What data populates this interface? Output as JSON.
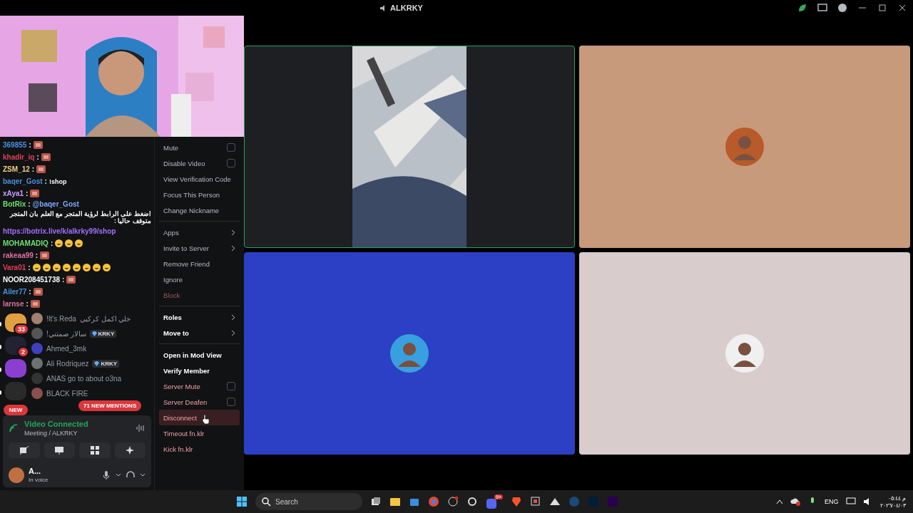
{
  "window": {
    "title": "ALKRKY"
  },
  "chat": [
    {
      "kind": "message",
      "user": "369855",
      "sep": ":",
      "color": "#4a90e2",
      "emotes": [
        {
          "kind": "sticker"
        }
      ]
    },
    {
      "kind": "message",
      "user": "khadir_iq",
      "sep": ":",
      "color": "#e0405a",
      "emotes": [
        {
          "kind": "sticker"
        }
      ]
    },
    {
      "kind": "message",
      "user": "ZSM_12",
      "sep": ":",
      "color": "#f0d080",
      "emotes": [
        {
          "kind": "sticker"
        }
      ]
    },
    {
      "kind": "message",
      "user": "baqer_Gost",
      "sep": ":",
      "color": "#4a90e2",
      "text": "!shop"
    },
    {
      "kind": "message",
      "user": "xAya1",
      "sep": ":",
      "color": "#c8a0ff",
      "emotes": [
        {
          "kind": "sticker"
        }
      ]
    },
    {
      "kind": "message",
      "user": "BotRix",
      "sep": ":",
      "color": "#6ee06e",
      "mention": "@baqer_Gost",
      "text": "اضغط على الرابط لرؤية المتجر مع العلم بان المتجر متوقف حاليا :"
    },
    {
      "kind": "link",
      "text": "https://botrix.live/k/alkrky99/shop"
    },
    {
      "kind": "message",
      "user": "MOHAMADIQ",
      "sep": ":",
      "color": "#6ee06e",
      "emotes": [
        {
          "kind": "laugh"
        },
        {
          "kind": "laugh"
        },
        {
          "kind": "laugh"
        }
      ]
    },
    {
      "kind": "message",
      "user": "rakeaa99",
      "sep": ":",
      "color": "#e070a0",
      "emotes": [
        {
          "kind": "sticker"
        }
      ]
    },
    {
      "kind": "message",
      "user": "Vara01",
      "sep": ":",
      "color": "#e0405a",
      "emotes": [
        {
          "kind": "laugh"
        },
        {
          "kind": "laugh"
        },
        {
          "kind": "laugh"
        },
        {
          "kind": "laugh"
        },
        {
          "kind": "laugh"
        },
        {
          "kind": "laugh"
        },
        {
          "kind": "laugh"
        },
        {
          "kind": "laugh"
        }
      ]
    },
    {
      "kind": "message",
      "user": "NOOR208451738",
      "sep": ":",
      "color": "#ffffff",
      "emotes": [
        {
          "kind": "sticker"
        }
      ]
    },
    {
      "kind": "message",
      "user": "Ailer77",
      "sep": ":",
      "color": "#4a90e2",
      "emotes": [
        {
          "kind": "sticker"
        }
      ]
    },
    {
      "kind": "message",
      "user": "larnse",
      "sep": ":",
      "color": "#e070a0",
      "emotes": [
        {
          "kind": "sticker"
        }
      ]
    }
  ],
  "servers": [
    {
      "badge": "33",
      "unread": true
    },
    {
      "badge": "2",
      "unread": true
    },
    {
      "unread": true
    },
    {
      "unread": true
    }
  ],
  "members": [
    {
      "name": "!It's Reda",
      "note": "خلي اكمل كركيي"
    },
    {
      "name": "سالار صمتني!",
      "badge": "KRKY"
    },
    {
      "name": "Ahmed_3mk"
    },
    {
      "name": "Ali Rodriquez",
      "badge": "KRKY"
    },
    {
      "name": "ANAS go to about o3na"
    },
    {
      "name": "BLACK FIRE"
    }
  ],
  "new_badge": "NEW",
  "mentions_badge": "71 NEW MENTIONS",
  "voice": {
    "status": "Video Connected",
    "channel": "Meeting / ALKRKY"
  },
  "user": {
    "name": "A...",
    "status": "In voice"
  },
  "menu": [
    {
      "kind": "check",
      "label": "Mute",
      "danger": false,
      "bold": false,
      "checked": false
    },
    {
      "kind": "check",
      "label": "Disable Video",
      "danger": false,
      "bold": false,
      "checked": false
    },
    {
      "kind": "item",
      "label": "View Verification Code",
      "danger": false,
      "bold": false,
      "disabled": false,
      "highlighted": false
    },
    {
      "kind": "item",
      "label": "Focus This Person",
      "danger": false,
      "bold": false,
      "disabled": false,
      "highlighted": false
    },
    {
      "kind": "item",
      "label": "Change Nickname",
      "danger": false,
      "bold": false,
      "disabled": false,
      "highlighted": false
    },
    {
      "kind": "separator"
    },
    {
      "kind": "submenu",
      "label": "Apps",
      "danger": false,
      "bold": false
    },
    {
      "kind": "submenu",
      "label": "Invite to Server",
      "danger": false,
      "bold": false
    },
    {
      "kind": "item",
      "label": "Remove Friend",
      "danger": false,
      "bold": false,
      "disabled": false,
      "highlighted": false
    },
    {
      "kind": "item",
      "label": "Ignore",
      "danger": false,
      "bold": false,
      "disabled": false,
      "highlighted": false
    },
    {
      "kind": "item",
      "label": "Block",
      "danger": true,
      "bold": false,
      "disabled": true,
      "highlighted": false
    },
    {
      "kind": "separator"
    },
    {
      "kind": "submenu",
      "label": "Roles",
      "danger": false,
      "bold": true
    },
    {
      "kind": "submenu",
      "label": "Move to",
      "danger": false,
      "bold": true
    },
    {
      "kind": "separator"
    },
    {
      "kind": "item",
      "label": "Open in Mod View",
      "danger": false,
      "bold": true,
      "disabled": false,
      "highlighted": false
    },
    {
      "kind": "item",
      "label": "Verify Member",
      "danger": false,
      "bold": true,
      "disabled": false,
      "highlighted": false
    },
    {
      "kind": "check",
      "label": "Server Mute",
      "danger": true,
      "bold": false,
      "checked": false
    },
    {
      "kind": "check",
      "label": "Server Deafen",
      "danger": true,
      "bold": false,
      "checked": false
    },
    {
      "kind": "item",
      "label": "Disconnect",
      "danger": true,
      "bold": false,
      "disabled": false,
      "highlighted": true
    },
    {
      "kind": "item",
      "label": "Timeout fn.klr",
      "danger": true,
      "bold": false,
      "disabled": false,
      "highlighted": false
    },
    {
      "kind": "item",
      "label": "Kick fn.klr",
      "danger": true,
      "bold": false,
      "disabled": false,
      "highlighted": false
    }
  ],
  "tiles": [
    {
      "kind": "video",
      "color": "#1e1f22",
      "speaking": true
    },
    {
      "kind": "avatar",
      "color": "#c89a7c",
      "speaking": false
    },
    {
      "kind": "avatar",
      "color": "#2b40c4",
      "speaking": false
    },
    {
      "kind": "avatar",
      "color": "#d9cccc",
      "speaking": false
    }
  ],
  "taskbar": {
    "search": {
      "placeholder": "Search"
    },
    "discord_badge": "9+",
    "language": "ENG",
    "time": "م ٠٥:٤٤",
    "date": "٢٠٢٦/٠٤/٠٣"
  }
}
